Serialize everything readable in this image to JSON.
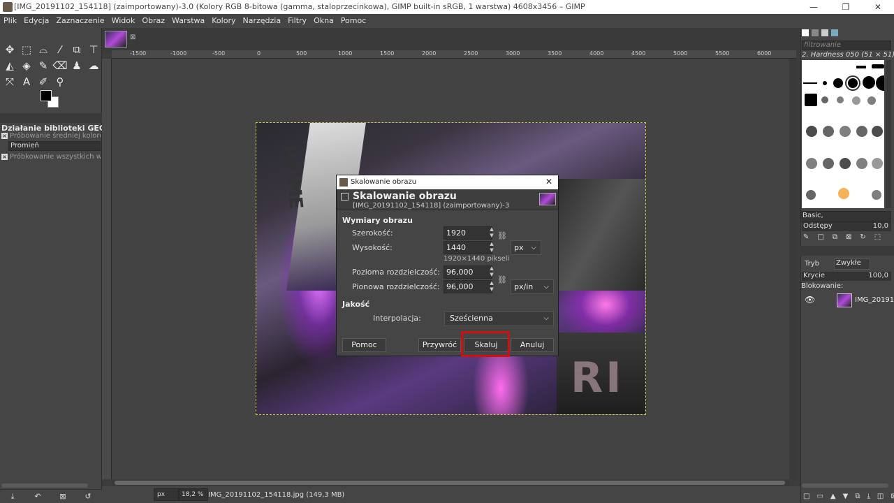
{
  "window": {
    "title": "[IMG_20191102_154118] (zaimportowany)-3.0 (Kolory RGB 8-bitowa (gamma, staloprzecinkowa), GIMP built-in sRGB, 1 warstwa) 4608x3456 – GIMP",
    "minimize": "—",
    "maximize": "❐",
    "close": "✕"
  },
  "menu": [
    "Plik",
    "Edycja",
    "Zaznaczenie",
    "Widok",
    "Obraz",
    "Warstwa",
    "Kolory",
    "Narzędzia",
    "Filtry",
    "Okna",
    "Pomoc"
  ],
  "toolbox": {
    "tools_row1": [
      "✥",
      "⬚",
      "⌓",
      "⁄",
      "⧉",
      "⊤"
    ],
    "tools_row2": [
      "◭",
      "◈",
      "✎",
      "⌫",
      "♟",
      "☁"
    ],
    "tools_row3": [
      "⤧",
      "A",
      "✐",
      "⚲"
    ],
    "gegl_title": "Działanie biblioteki GEGL",
    "option1": "Próbowanie średniej kolorów",
    "radius": "Promień",
    "option2": "Próbkowanie wszystkich warstw",
    "bottom_icons": [
      "⤓",
      "↶",
      "⊠",
      "↺"
    ]
  },
  "ruler": {
    "ticks": [
      {
        "label": "-1500"
      },
      {
        "label": "-1000"
      },
      {
        "label": "-500"
      },
      {
        "label": "0"
      },
      {
        "label": "500"
      },
      {
        "label": "1000"
      },
      {
        "label": "1500"
      },
      {
        "label": "2000"
      },
      {
        "label": "2500"
      },
      {
        "label": "3000"
      },
      {
        "label": "3500"
      },
      {
        "label": "4000"
      },
      {
        "label": "4500"
      },
      {
        "label": "5000"
      },
      {
        "label": "5500"
      },
      {
        "label": "6000"
      }
    ]
  },
  "dialog": {
    "window_title": "Skalowanie obrazu",
    "heading": "Skalowanie obrazu",
    "subheading": "[IMG_20191102_154118] (zaimportowany)-3",
    "section_size": "Wymiary obrazu",
    "width_label": "Szerokość:",
    "width_value": "1920",
    "height_label": "Wysokość:",
    "height_value": "1440",
    "size_unit": "px",
    "pixels_info": "1920×1440 pikseli",
    "xres_label": "Pozioma rozdzielczość:",
    "xres_value": "96,000",
    "yres_label": "Pionowa rozdzielczość:",
    "yres_value": "96,000",
    "res_unit": "px/in",
    "section_quality": "Jakość",
    "interp_label": "Interpolacja:",
    "interp_value": "Sześcienna",
    "btn_help": "Pomoc",
    "btn_reset": "Przywróć",
    "btn_scale": "Skaluj",
    "btn_cancel": "Anuluj",
    "close": "✕"
  },
  "rightdock": {
    "filter_placeholder": "filtrowanie",
    "brush_name": "2. Hardness 050 (51 × 51)",
    "preset": "Basic,",
    "spacing_label": "Odstępy",
    "spacing_value": "10,0",
    "mode_label": "Tryb",
    "mode_value": "Zwykłe",
    "opacity_label": "Krycie",
    "opacity_value": "100,0",
    "lock_label": "Blokowanie:",
    "layer_name": "IMG_20191"
  },
  "status": {
    "unit": "px",
    "zoom": "18,2 %",
    "info": "IMG_20191102_154118.jpg (149,3 MB)"
  },
  "image_text": {
    "rim": "RI",
    "prime": "PRIME"
  }
}
